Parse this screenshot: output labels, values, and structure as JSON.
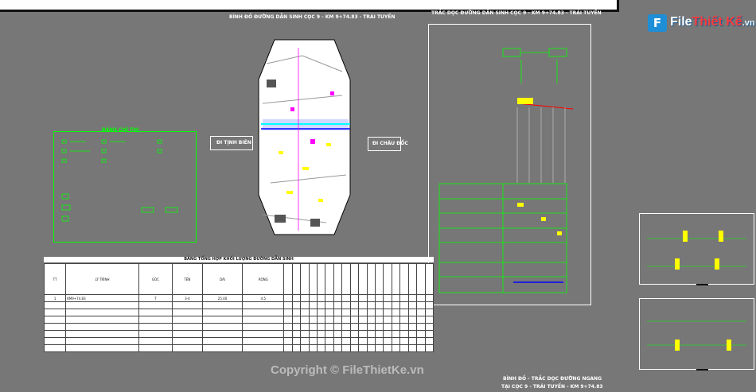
{
  "brand": {
    "logo_letter": "F",
    "logo_name": "File",
    "logo_accent": "Thiết Kế",
    "logo_suffix": ".vn"
  },
  "plan": {
    "title": "BÌNH ĐỒ ĐƯỜNG DẪN SINH CỌC 9 - KM 9+74.83 - TRÁI TUYẾN",
    "left_arrow": "ĐI TỊNH BIÊN",
    "right_arrow": "ĐI CHÂU ĐỐC"
  },
  "legend": {
    "title": "BẢNG CHỈ THỊ"
  },
  "profile": {
    "title": "TRẮC DỌC ĐƯỜNG DẪN SINH CỌC 9 - KM 9+74.83 - TRÁI TUYẾN",
    "rows": [
      "",
      "",
      "",
      "",
      "",
      "",
      ""
    ]
  },
  "table": {
    "title": "BẢNG TỔNG HỢP KHỐI LƯỢNG ĐƯỜNG DẪN SINH",
    "row1": {
      "tt": "1",
      "ly_trinh": "KM9+74.83",
      "goc": "T",
      "ten": "3-4",
      "dai": "25.00",
      "rong": "4.5"
    }
  },
  "caption": {
    "line1": "BÌNH ĐỒ - TRẮC DỌC ĐƯỜNG NGANG",
    "line2": "TẠI CỌC 9 - TRÁI TUYẾN - KM 9+74.83"
  },
  "watermark": "Copyright © FileThietKe.vn",
  "colors": {
    "background": "#777777",
    "cad_green": "#00ff00",
    "cad_yellow": "#ffff00",
    "cad_cyan": "#00ffff",
    "cad_magenta": "#ff00ff"
  }
}
